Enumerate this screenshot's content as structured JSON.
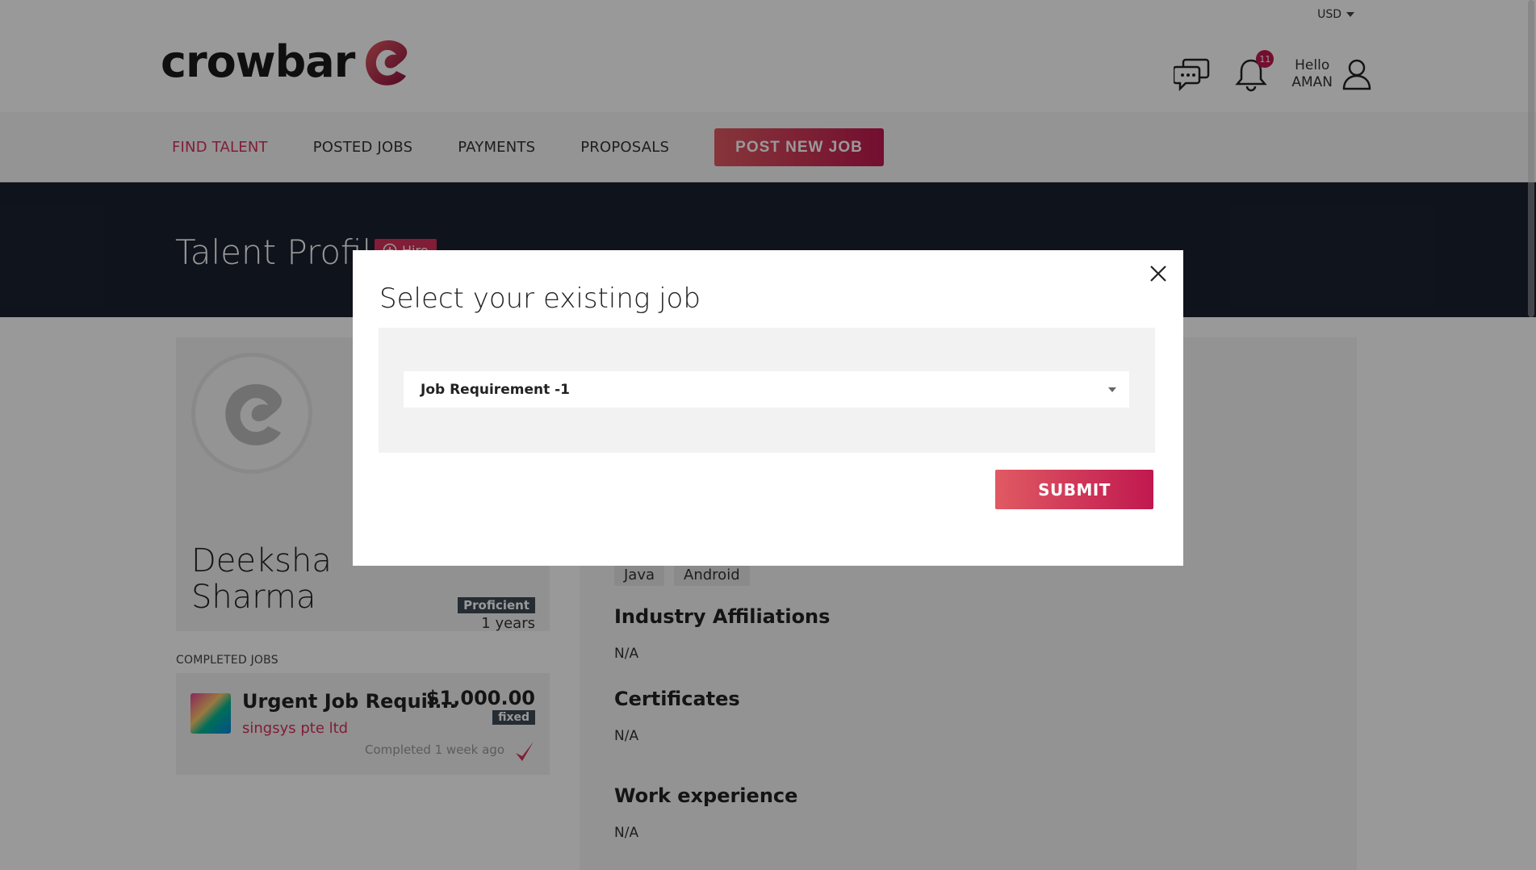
{
  "header": {
    "currency": "USD",
    "logo_text": "crowbar",
    "notification_count": "11",
    "greeting_line1": "Hello",
    "greeting_line2": "AMAN"
  },
  "nav": {
    "items": [
      {
        "label": "FIND TALENT"
      },
      {
        "label": "POSTED JOBS"
      },
      {
        "label": "PAYMENTS"
      },
      {
        "label": "PROPOSALS"
      }
    ],
    "post_job_label": "POST NEW JOB"
  },
  "banner": {
    "title": "Talent Profile",
    "hire_label": "Hire"
  },
  "profile": {
    "name": "Deeksha Sharma",
    "level": "Proficient",
    "experience": "1 years"
  },
  "completed_jobs": {
    "label": "COMPLETED JOBS",
    "items": [
      {
        "title": "Urgent Job Requir...",
        "company": "singsys pte ltd",
        "price": "$1,000.00",
        "type": "fixed",
        "completed": "Completed 1 week ago"
      }
    ]
  },
  "details": {
    "skills": [
      "Java",
      "Android"
    ],
    "sections": [
      {
        "heading": "Industry Affiliations",
        "value": "N/A"
      },
      {
        "heading": "Certificates",
        "value": "N/A"
      },
      {
        "heading": "Work experience",
        "value": "N/A"
      }
    ]
  },
  "modal": {
    "title": "Select your existing job",
    "selected_job": "Job Requirement -1",
    "submit_label": "SUBMIT"
  },
  "colors": {
    "accent": "#d8315b",
    "banner": "#1a2130",
    "badge": "#3e4a56"
  }
}
